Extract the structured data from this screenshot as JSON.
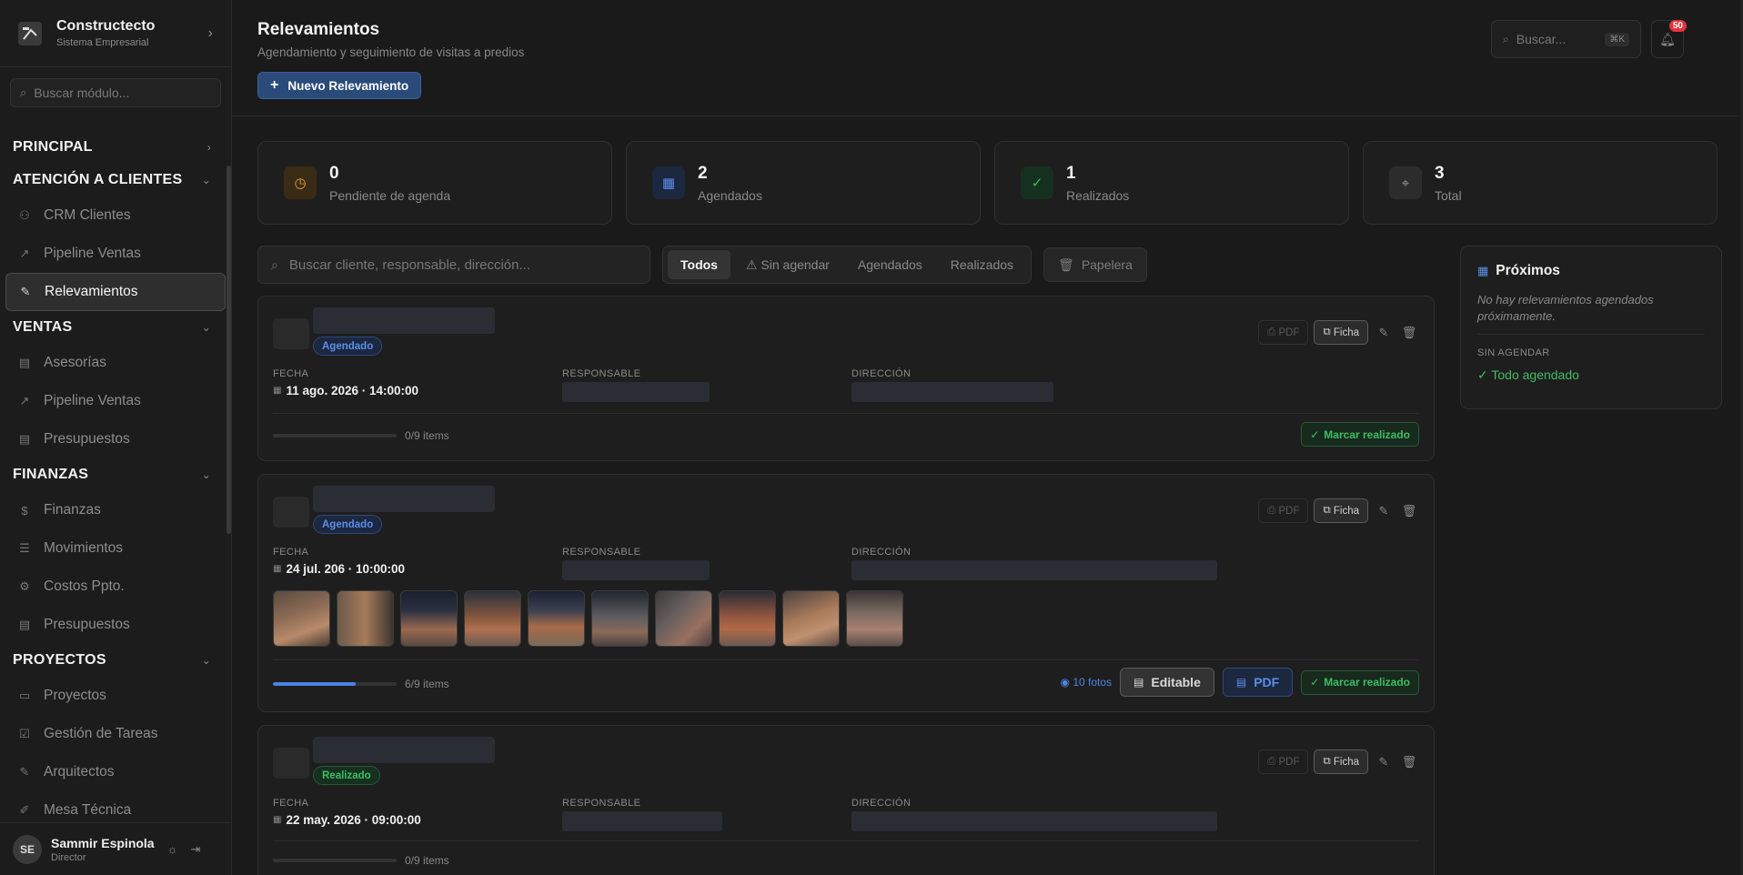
{
  "brand": {
    "name": "Constructecto",
    "subtitle": "Sistema Empresarial"
  },
  "sidebar": {
    "search_placeholder": "Buscar módulo...",
    "sections": [
      {
        "label": "PRINCIPAL",
        "collapsed": true,
        "items": []
      },
      {
        "label": "ATENCIÓN A CLIENTES",
        "items": [
          {
            "label": "CRM Clientes",
            "icon": "users-icon"
          },
          {
            "label": "Pipeline Ventas",
            "icon": "trending-icon"
          },
          {
            "label": "Relevamientos",
            "icon": "ruler-icon",
            "active": true
          }
        ]
      },
      {
        "label": "VENTAS",
        "items": [
          {
            "label": "Asesorías",
            "icon": "file-icon"
          },
          {
            "label": "Pipeline Ventas",
            "icon": "trending-icon"
          },
          {
            "label": "Presupuestos",
            "icon": "file-icon"
          }
        ]
      },
      {
        "label": "FINANZAS",
        "items": [
          {
            "label": "Finanzas",
            "icon": "dollar-icon"
          },
          {
            "label": "Movimientos",
            "icon": "list-icon"
          },
          {
            "label": "Costos Ppto.",
            "icon": "gear-icon"
          },
          {
            "label": "Presupuestos",
            "icon": "file-icon"
          }
        ]
      },
      {
        "label": "PROYECTOS",
        "items": [
          {
            "label": "Proyectos",
            "icon": "folder-icon"
          },
          {
            "label": "Gestión de Tareas",
            "icon": "checkbox-icon"
          },
          {
            "label": "Arquitectos",
            "icon": "ruler-icon"
          },
          {
            "label": "Mesa Técnica",
            "icon": "wrench-icon"
          }
        ]
      }
    ]
  },
  "user": {
    "initials": "SE",
    "name": "Sammir Espinola",
    "role": "Director"
  },
  "header": {
    "title": "Relevamientos",
    "subtitle": "Agendamiento y seguimiento de visitas a predios",
    "new_button": "Nuevo Relevamiento",
    "search_placeholder": "Buscar...",
    "search_shortcut": "⌘K",
    "notif_count": "50"
  },
  "stats": [
    {
      "value": "0",
      "label": "Pendiente de agenda",
      "icon": "clock-icon",
      "color": "#e0a33a"
    },
    {
      "value": "2",
      "label": "Agendados",
      "icon": "calendar-icon",
      "color": "#5b8fe8"
    },
    {
      "value": "1",
      "label": "Realizados",
      "icon": "check-circle-icon",
      "color": "#3fbd62"
    },
    {
      "value": "3",
      "label": "Total",
      "icon": "pin-icon",
      "color": "#9a9a9a"
    }
  ],
  "toolbar": {
    "search_placeholder": "Buscar cliente, responsable, dirección...",
    "filters": [
      "Todos",
      "⚠ Sin agendar",
      "Agendados",
      "Realizados"
    ],
    "trash": "Papelera"
  },
  "labels": {
    "fecha": "FECHA",
    "responsable": "RESPONSABLE",
    "direccion": "DIRECCIÓN",
    "pdf": "PDF",
    "ficha": "Ficha",
    "marcar": "Marcar realizado",
    "editable": "Editable"
  },
  "cards": [
    {
      "status": "Agendado",
      "fecha": "11 ago. 2026 · 14:00:00",
      "progress_text": "0/9 items",
      "progress": 0
    },
    {
      "status": "Agendado",
      "fecha": "24 jul. 206 · 10:00:00",
      "progress_text": "6/9 items",
      "progress": 0.667,
      "fotos": "10 fotos"
    },
    {
      "status": "Realizado",
      "fecha": "22 may. 2026 · 09:00:00",
      "progress_text": "0/9 items",
      "progress": 0
    }
  ],
  "proximos": {
    "title": "Próximos",
    "empty": "No hay relevamientos agendados próximamente.",
    "sin_agendar_label": "SIN AGENDAR",
    "sin_agendar_value": "✓ Todo agendado"
  }
}
